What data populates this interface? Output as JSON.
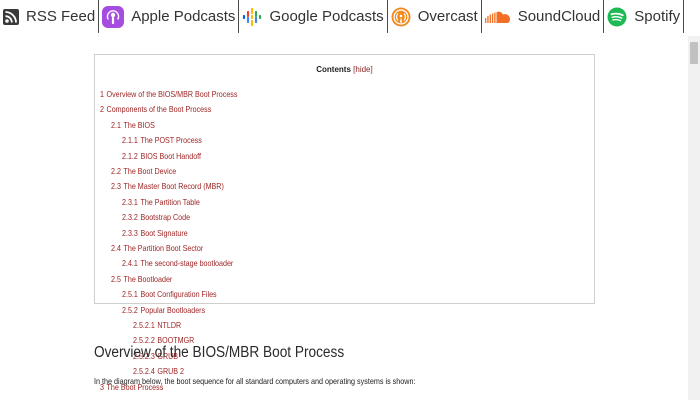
{
  "podcast_bar": {
    "items": [
      {
        "label": "RSS Feed",
        "icon": "rss-icon"
      },
      {
        "label": "Apple Podcasts",
        "icon": "apple-podcasts-icon"
      },
      {
        "label": "Google Podcasts",
        "icon": "google-podcasts-icon"
      },
      {
        "label": "Overcast",
        "icon": "overcast-icon"
      },
      {
        "label": "SoundCloud",
        "icon": "soundcloud-icon"
      },
      {
        "label": "Spotify",
        "icon": "spotify-icon"
      }
    ]
  },
  "colors": {
    "link": "#9e2424",
    "apple_purple": "#a54de0",
    "overcast_orange": "#f28a1e",
    "soundcloud_orange": "#f26f23",
    "spotify_green": "#1db954"
  },
  "toc": {
    "title": "Contents",
    "hide_label": "[hide]",
    "items": [
      {
        "num": "1",
        "text": "Overview of the BIOS/MBR Boot Process"
      },
      {
        "num": "2",
        "text": "Components of the Boot Process"
      },
      {
        "num": "2.1",
        "text": "The BIOS"
      },
      {
        "num": "2.1.1",
        "text": "The POST Process"
      },
      {
        "num": "2.1.2",
        "text": "BIOS Boot Handoff"
      },
      {
        "num": "2.2",
        "text": "The Boot Device"
      },
      {
        "num": "2.3",
        "text": "The Master Boot Record (MBR)"
      },
      {
        "num": "2.3.1",
        "text": "The Partition Table"
      },
      {
        "num": "2.3.2",
        "text": "Bootstrap Code"
      },
      {
        "num": "2.3.3",
        "text": "Boot Signature"
      },
      {
        "num": "2.4",
        "text": "The Partition Boot Sector"
      },
      {
        "num": "2.4.1",
        "text": "The second-stage bootloader"
      },
      {
        "num": "2.5",
        "text": "The Bootloader"
      },
      {
        "num": "2.5.1",
        "text": "Boot Configuration Files"
      },
      {
        "num": "2.5.2",
        "text": "Popular Bootloaders"
      },
      {
        "num": "2.5.2.1",
        "text": "NTLDR"
      },
      {
        "num": "2.5.2.2",
        "text": "BOOTMGR"
      },
      {
        "num": "2.5.2.3",
        "text": "GRUB"
      },
      {
        "num": "2.5.2.4",
        "text": "GRUB 2"
      },
      {
        "num": "3",
        "text": "The Boot Process"
      }
    ]
  },
  "article": {
    "heading": "Overview of the BIOS/MBR Boot Process",
    "paragraph": "In the diagram below, the boot sequence for all standard computers and operating systems is shown:"
  }
}
